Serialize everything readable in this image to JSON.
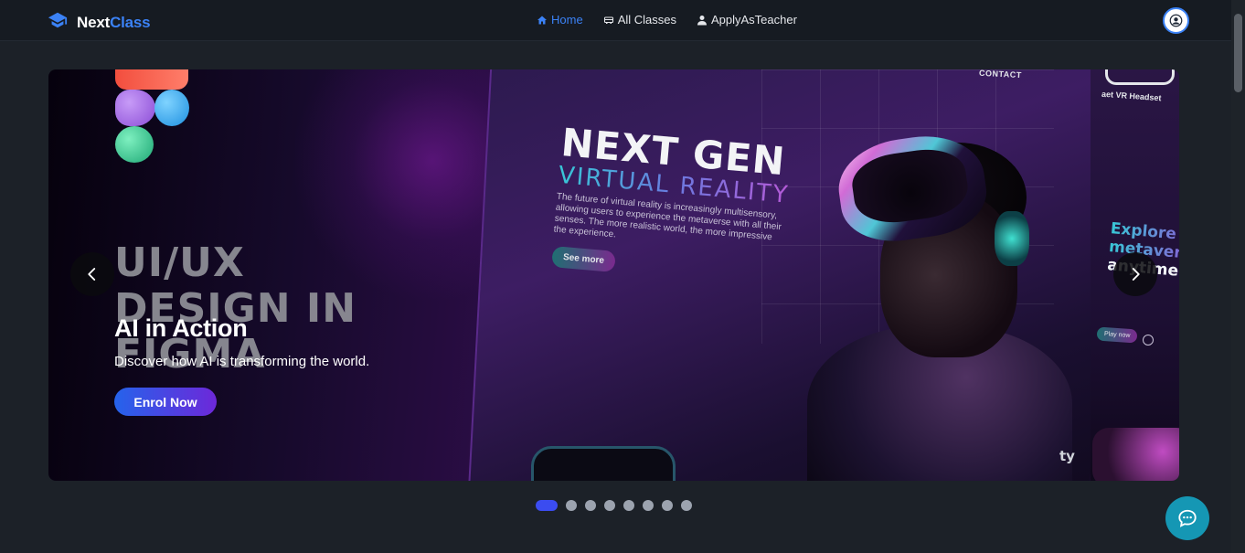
{
  "brand": {
    "name_part1": "Next",
    "name_part2": "Class",
    "logo_icon": "graduation-cap-icon",
    "accent": "#3b82f6"
  },
  "nav": {
    "items": [
      {
        "label": "Home",
        "icon": "home-icon",
        "active": true
      },
      {
        "label": "All Classes",
        "icon": "classes-icon",
        "active": false
      },
      {
        "label": "ApplyAsTeacher",
        "icon": "user-icon",
        "active": false
      }
    ],
    "profile_icon": "user-circle-icon"
  },
  "hero": {
    "slide_title": "AI in Action",
    "slide_description": "Discover how AI is transforming the world.",
    "cta_label": "Enrol Now",
    "image_text": {
      "design_heading_line1": "UI/UX",
      "design_heading_line2": "DESIGN IN",
      "design_heading_line3": "FIGMA",
      "contact": "CONTACT",
      "headline": "NEXT GEN",
      "subheadline": "VIRTUAL REALITY",
      "body": "The future of virtual reality is increasingly multisensory, allowing users to experience the metaverse with all their senses. The more realistic world, the more impressive the experience.",
      "see_more": "See more",
      "vr_headset": "aet VR Headset",
      "explore_line1": "Explore",
      "explore_line2": "metavers",
      "explore_line3": "anytime",
      "play_now": "Play now",
      "partial_word": "ty"
    }
  },
  "carousel": {
    "total_slides": 8,
    "active_index": 0
  },
  "chat": {
    "icon": "chat-bubble-icon",
    "color": "#1597b4"
  }
}
